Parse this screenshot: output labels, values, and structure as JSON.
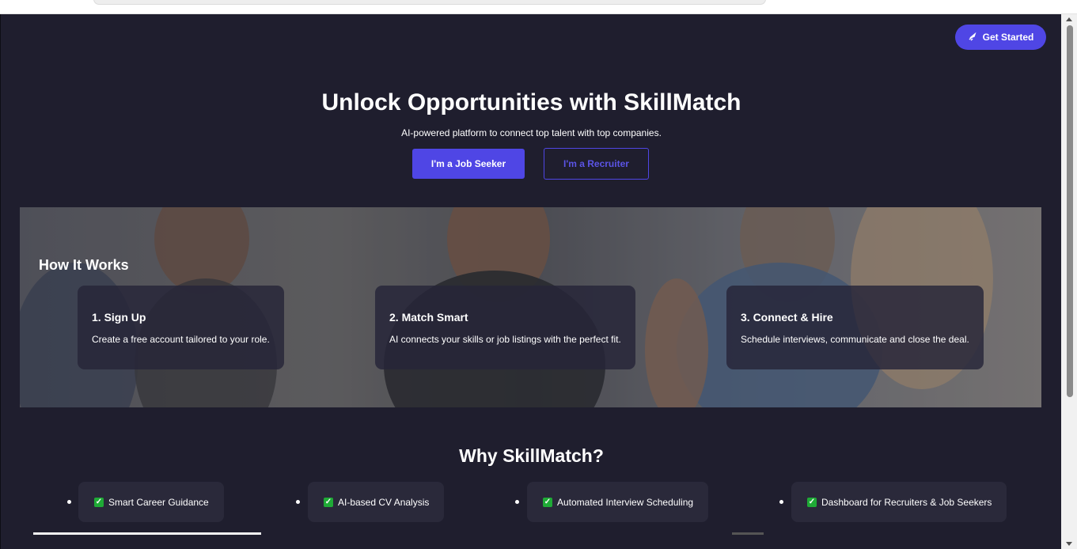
{
  "header": {
    "get_started_label": "Get Started",
    "icon": "rocket-icon"
  },
  "hero": {
    "title": "Unlock Opportunities with SkillMatch",
    "subtitle": "AI-powered platform to connect top talent with top companies.",
    "seeker_label": "I'm a Job Seeker",
    "recruiter_label": "I'm a Recruiter"
  },
  "how": {
    "title": "How It Works",
    "steps": [
      {
        "title": "1. Sign Up",
        "desc": "Create a free account tailored to your role."
      },
      {
        "title": "2. Match Smart",
        "desc": "AI connects your skills or job listings with the perfect fit."
      },
      {
        "title": "3. Connect & Hire",
        "desc": "Schedule interviews, communicate and close the deal."
      }
    ]
  },
  "why": {
    "title": "Why SkillMatch?",
    "features": [
      "Smart Career Guidance",
      "AI-based CV Analysis",
      "Automated Interview Scheduling",
      "Dashboard for Recruiters & Job Seekers"
    ]
  },
  "colors": {
    "background": "#1f1e2e",
    "accent": "#4f46e5",
    "card": "#2a293a",
    "check": "#1faa36"
  }
}
